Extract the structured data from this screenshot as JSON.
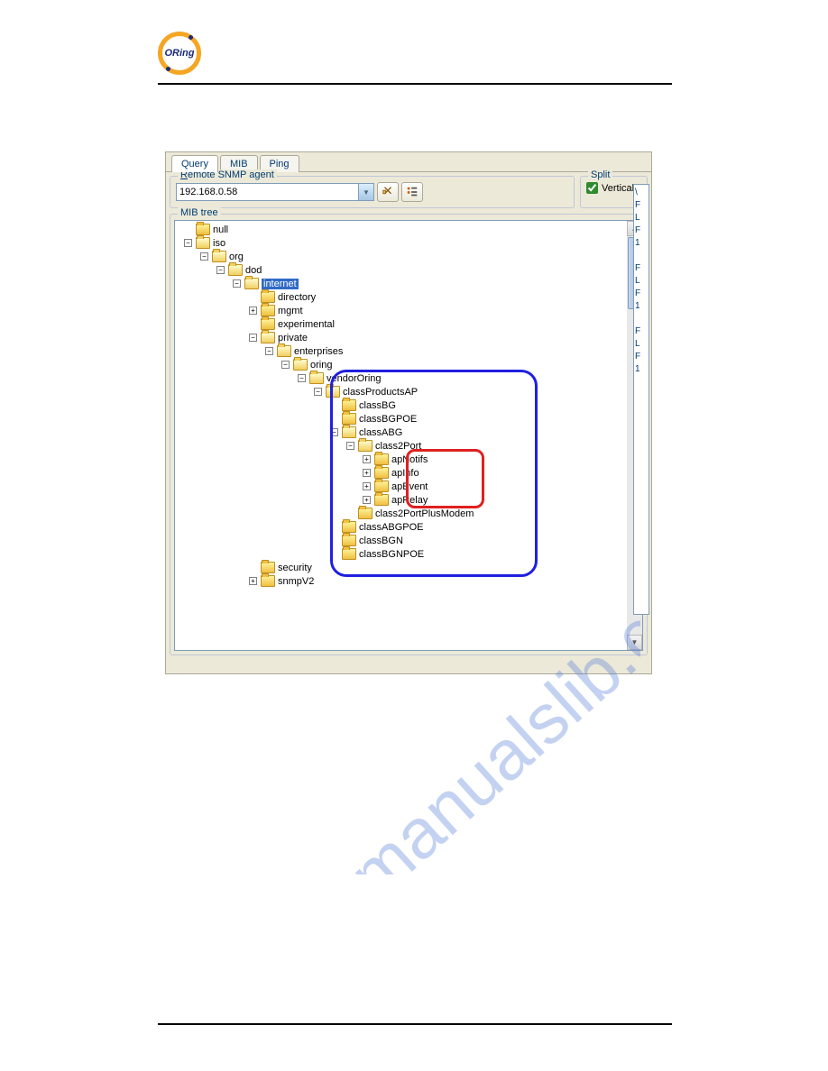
{
  "logo": {
    "text": "ORing"
  },
  "tabs": [
    {
      "label": "Query",
      "active": true
    },
    {
      "label": "MIB",
      "active": false
    },
    {
      "label": "Ping",
      "active": false
    }
  ],
  "remoteGroup": {
    "prefix": "R",
    "rest": "emote SNMP agent",
    "value": "192.168.0.58"
  },
  "splitGroup": {
    "title": "Split",
    "checkbox": {
      "label": "Vertical",
      "checked": true
    }
  },
  "mibTree": {
    "title": "MIB tree"
  },
  "tree": [
    {
      "indent": 0,
      "exp": "none",
      "folder": "closed",
      "label": "null",
      "selected": false
    },
    {
      "indent": 0,
      "exp": "minus",
      "folder": "open",
      "label": "iso",
      "selected": false
    },
    {
      "indent": 1,
      "exp": "minus",
      "folder": "open",
      "label": "org",
      "selected": false
    },
    {
      "indent": 2,
      "exp": "minus",
      "folder": "open",
      "label": "dod",
      "selected": false
    },
    {
      "indent": 3,
      "exp": "minus",
      "folder": "open",
      "label": "internet",
      "selected": true
    },
    {
      "indent": 4,
      "exp": "none",
      "folder": "closed",
      "label": "directory",
      "selected": false
    },
    {
      "indent": 4,
      "exp": "plus",
      "folder": "closed",
      "label": "mgmt",
      "selected": false
    },
    {
      "indent": 4,
      "exp": "none",
      "folder": "closed",
      "label": "experimental",
      "selected": false
    },
    {
      "indent": 4,
      "exp": "minus",
      "folder": "open",
      "label": "private",
      "selected": false
    },
    {
      "indent": 5,
      "exp": "minus",
      "folder": "open",
      "label": "enterprises",
      "selected": false
    },
    {
      "indent": 6,
      "exp": "minus",
      "folder": "open",
      "label": "oring",
      "selected": false
    },
    {
      "indent": 7,
      "exp": "minus",
      "folder": "open",
      "label": "vendorOring",
      "selected": false
    },
    {
      "indent": 8,
      "exp": "minus",
      "folder": "open",
      "label": "classProductsAP",
      "selected": false
    },
    {
      "indent": 9,
      "exp": "none",
      "folder": "closed",
      "label": "classBG",
      "selected": false
    },
    {
      "indent": 9,
      "exp": "none",
      "folder": "closed",
      "label": "classBGPOE",
      "selected": false
    },
    {
      "indent": 9,
      "exp": "minus",
      "folder": "open",
      "label": "classABG",
      "selected": false
    },
    {
      "indent": 10,
      "exp": "minus",
      "folder": "open",
      "label": "class2Port",
      "selected": false
    },
    {
      "indent": 11,
      "exp": "plus",
      "folder": "closed",
      "label": "apNotifs",
      "selected": false
    },
    {
      "indent": 11,
      "exp": "plus",
      "folder": "closed",
      "label": "apInfo",
      "selected": false
    },
    {
      "indent": 11,
      "exp": "plus",
      "folder": "closed",
      "label": "apEvent",
      "selected": false
    },
    {
      "indent": 11,
      "exp": "plus",
      "folder": "closed",
      "label": "apRelay",
      "selected": false
    },
    {
      "indent": 10,
      "exp": "none",
      "folder": "closed",
      "label": "class2PortPlusModem",
      "selected": false
    },
    {
      "indent": 9,
      "exp": "none",
      "folder": "closed",
      "label": "classABGPOE",
      "selected": false
    },
    {
      "indent": 9,
      "exp": "none",
      "folder": "closed",
      "label": "classBGN",
      "selected": false
    },
    {
      "indent": 9,
      "exp": "none",
      "folder": "closed",
      "label": "classBGNPOE",
      "selected": false
    },
    {
      "indent": 4,
      "exp": "none",
      "folder": "closed",
      "label": "security",
      "selected": false
    },
    {
      "indent": 4,
      "exp": "plus",
      "folder": "closed",
      "label": "snmpV2",
      "selected": false
    }
  ],
  "sideText": "\\\nF\nL\nF\n1\n\nF\nL\nF\n1\n\nF\nL\nF\n1",
  "watermark": "manualslib.com"
}
